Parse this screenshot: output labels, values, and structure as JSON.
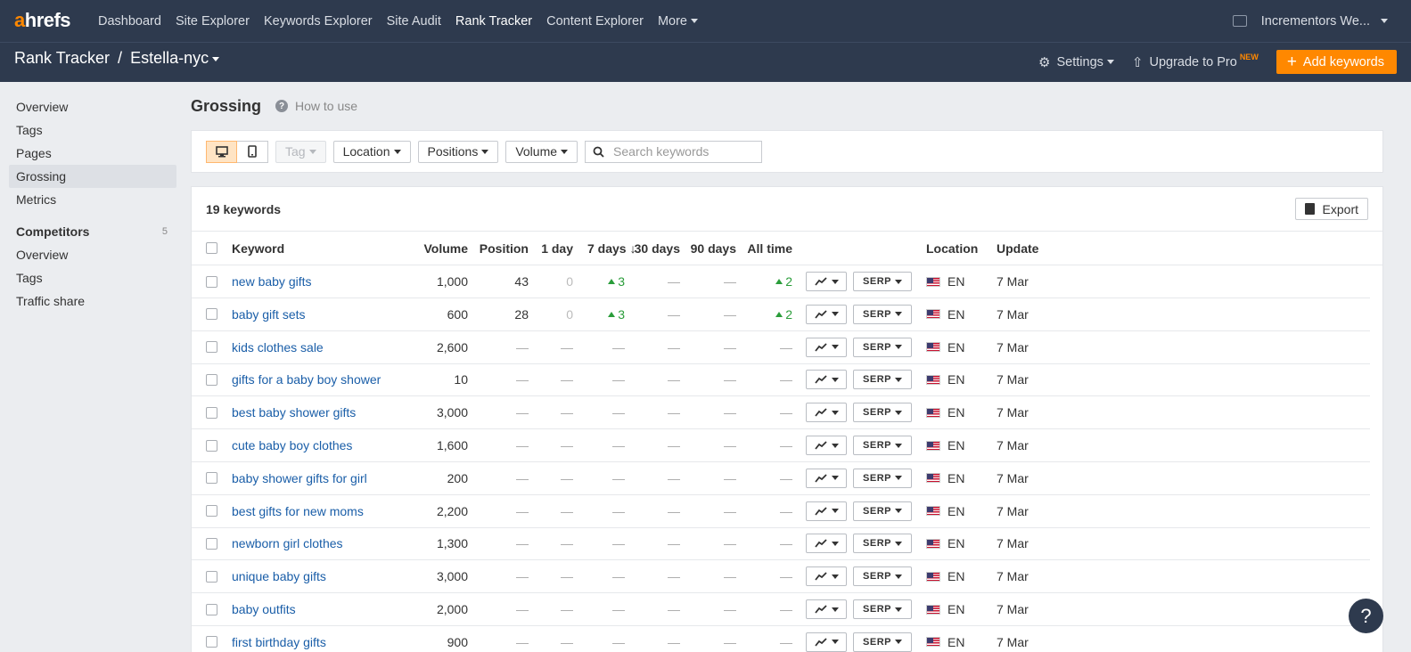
{
  "nav": {
    "logo_a": "a",
    "logo_rest": "hrefs",
    "links": [
      "Dashboard",
      "Site Explorer",
      "Keywords Explorer",
      "Site Audit",
      "Rank Tracker",
      "Content Explorer"
    ],
    "more": "More",
    "account": "Incrementors We..."
  },
  "sub": {
    "product": "Rank Tracker",
    "separator": "/",
    "project": "Estella-nyc",
    "settings": "Settings",
    "upgrade": "Upgrade to Pro",
    "upgrade_badge": "NEW",
    "add_keywords": "Add keywords"
  },
  "sidebar": {
    "items": [
      "Overview",
      "Tags",
      "Pages",
      "Grossing",
      "Metrics"
    ],
    "competitors_title": "Competitors",
    "competitors_count": "5",
    "competitor_items": [
      "Overview",
      "Tags",
      "Traffic share"
    ]
  },
  "page": {
    "title": "Grossing",
    "how_to_use": "How to use"
  },
  "filters": {
    "tag": "Tag",
    "location": "Location",
    "positions": "Positions",
    "volume": "Volume",
    "search_placeholder": "Search keywords"
  },
  "table": {
    "count_label": "19 keywords",
    "export": "Export",
    "headers": {
      "keyword": "Keyword",
      "volume": "Volume",
      "position": "Position",
      "d1": "1 day",
      "d7": "7 days",
      "d30": "30 days",
      "d90": "90 days",
      "all": "All time",
      "location": "Location",
      "update": "Update"
    },
    "serp_label": "SERP",
    "rows": [
      {
        "keyword": "new baby gifts",
        "volume": "1,000",
        "position": "43",
        "d1": "0",
        "d7": "3",
        "d30": "—",
        "d90": "—",
        "all": "2",
        "lang": "EN",
        "update": "7 Mar"
      },
      {
        "keyword": "baby gift sets",
        "volume": "600",
        "position": "28",
        "d1": "0",
        "d7": "3",
        "d30": "—",
        "d90": "—",
        "all": "2",
        "lang": "EN",
        "update": "7 Mar"
      },
      {
        "keyword": "kids clothes sale",
        "volume": "2,600",
        "position": "—",
        "d1": "—",
        "d7": "—",
        "d30": "—",
        "d90": "—",
        "all": "—",
        "lang": "EN",
        "update": "7 Mar"
      },
      {
        "keyword": "gifts for a baby boy shower",
        "volume": "10",
        "position": "—",
        "d1": "—",
        "d7": "—",
        "d30": "—",
        "d90": "—",
        "all": "—",
        "lang": "EN",
        "update": "7 Mar"
      },
      {
        "keyword": "best baby shower gifts",
        "volume": "3,000",
        "position": "—",
        "d1": "—",
        "d7": "—",
        "d30": "—",
        "d90": "—",
        "all": "—",
        "lang": "EN",
        "update": "7 Mar"
      },
      {
        "keyword": "cute baby boy clothes",
        "volume": "1,600",
        "position": "—",
        "d1": "—",
        "d7": "—",
        "d30": "—",
        "d90": "—",
        "all": "—",
        "lang": "EN",
        "update": "7 Mar"
      },
      {
        "keyword": "baby shower gifts for girl",
        "volume": "200",
        "position": "—",
        "d1": "—",
        "d7": "—",
        "d30": "—",
        "d90": "—",
        "all": "—",
        "lang": "EN",
        "update": "7 Mar"
      },
      {
        "keyword": "best gifts for new moms",
        "volume": "2,200",
        "position": "—",
        "d1": "—",
        "d7": "—",
        "d30": "—",
        "d90": "—",
        "all": "—",
        "lang": "EN",
        "update": "7 Mar"
      },
      {
        "keyword": "newborn girl clothes",
        "volume": "1,300",
        "position": "—",
        "d1": "—",
        "d7": "—",
        "d30": "—",
        "d90": "—",
        "all": "—",
        "lang": "EN",
        "update": "7 Mar"
      },
      {
        "keyword": "unique baby gifts",
        "volume": "3,000",
        "position": "—",
        "d1": "—",
        "d7": "—",
        "d30": "—",
        "d90": "—",
        "all": "—",
        "lang": "EN",
        "update": "7 Mar"
      },
      {
        "keyword": "baby outfits",
        "volume": "2,000",
        "position": "—",
        "d1": "—",
        "d7": "—",
        "d30": "—",
        "d90": "—",
        "all": "—",
        "lang": "EN",
        "update": "7 Mar"
      },
      {
        "keyword": "first birthday gifts",
        "volume": "900",
        "position": "—",
        "d1": "—",
        "d7": "—",
        "d30": "—",
        "d90": "—",
        "all": "—",
        "lang": "EN",
        "update": "7 Mar"
      }
    ]
  },
  "help_label": "?",
  "colors": {
    "nav_bg": "#2e3a4e",
    "accent": "#ff8800",
    "link": "#1a5ea8",
    "positive": "#2a9d3a"
  }
}
